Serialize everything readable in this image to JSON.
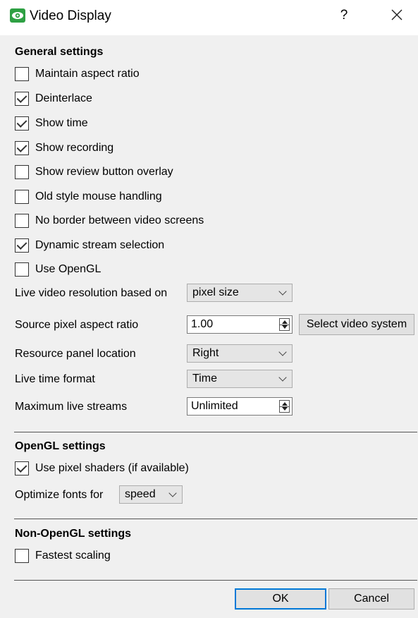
{
  "window": {
    "title": "Video Display",
    "help_label": "?",
    "close_icon": "close-icon",
    "app_icon": "eye-icon",
    "icon_color": "#2ea043"
  },
  "general": {
    "title": "General settings",
    "checkboxes": [
      {
        "label": "Maintain aspect ratio",
        "checked": false
      },
      {
        "label": "Deinterlace",
        "checked": true
      },
      {
        "label": "Show time",
        "checked": true
      },
      {
        "label": "Show recording",
        "checked": true
      },
      {
        "label": "Show review button overlay",
        "checked": false
      },
      {
        "label": "Old style mouse handling",
        "checked": false
      },
      {
        "label": "No border between video screens",
        "checked": false
      },
      {
        "label": "Dynamic stream selection",
        "checked": true
      },
      {
        "label": "Use OpenGL",
        "checked": false
      }
    ],
    "live_resolution": {
      "label": "Live video resolution based on",
      "value": "pixel size"
    },
    "pixel_aspect": {
      "label": "Source pixel aspect ratio",
      "value": "1.00",
      "button": "Select video system"
    },
    "resource_panel": {
      "label": "Resource panel location",
      "value": "Right"
    },
    "live_time_format": {
      "label": "Live time format",
      "value": "Time"
    },
    "max_streams": {
      "label": "Maximum live streams",
      "value": "Unlimited"
    }
  },
  "opengl": {
    "title": "OpenGL settings",
    "pixel_shaders": {
      "label": "Use pixel shaders (if available)",
      "checked": true
    },
    "optimize": {
      "label": "Optimize fonts for",
      "value": "speed"
    }
  },
  "non_opengl": {
    "title": "Non-OpenGL settings",
    "fastest_scaling": {
      "label": "Fastest scaling",
      "checked": false
    }
  },
  "footer": {
    "ok": "OK",
    "cancel": "Cancel"
  }
}
